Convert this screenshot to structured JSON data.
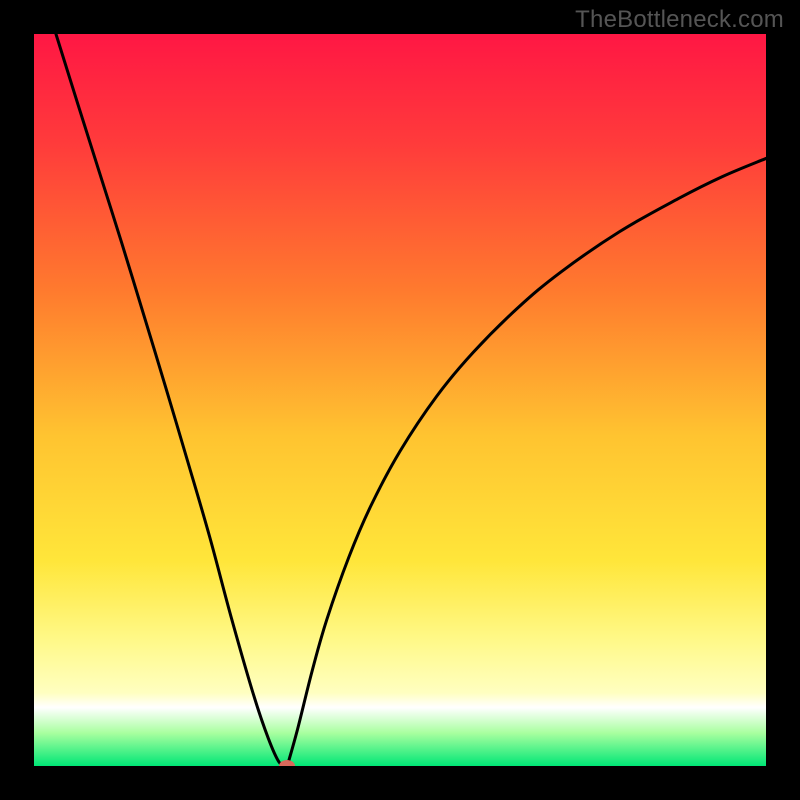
{
  "watermark": "TheBottleneck.com",
  "chart_data": {
    "type": "line",
    "title": "",
    "xlabel": "",
    "ylabel": "",
    "xlim": [
      0,
      100
    ],
    "ylim": [
      0,
      100
    ],
    "grid": false,
    "legend": false,
    "background_gradient_stops": [
      {
        "pct": 0,
        "color": "#ff1744"
      },
      {
        "pct": 15,
        "color": "#ff3b3b"
      },
      {
        "pct": 35,
        "color": "#ff7a2e"
      },
      {
        "pct": 55,
        "color": "#ffc430"
      },
      {
        "pct": 72,
        "color": "#ffe63a"
      },
      {
        "pct": 83,
        "color": "#fff98a"
      },
      {
        "pct": 90,
        "color": "#ffffc0"
      },
      {
        "pct": 92,
        "color": "#ffffff"
      },
      {
        "pct": 95.5,
        "color": "#a8ff9f"
      },
      {
        "pct": 100,
        "color": "#00e676"
      }
    ],
    "series": [
      {
        "name": "left-branch",
        "x": [
          3,
          6,
          9,
          12,
          15,
          18,
          21,
          24,
          27,
          30,
          32,
          33.5,
          34.6
        ],
        "y": [
          100,
          90.4,
          80.9,
          71.4,
          61.6,
          51.7,
          41.6,
          31.3,
          20.1,
          9.7,
          3.8,
          0.5,
          0
        ]
      },
      {
        "name": "right-branch",
        "x": [
          34.6,
          36,
          38,
          40,
          43,
          46,
          50,
          55,
          60,
          66,
          72,
          80,
          88,
          94,
          100
        ],
        "y": [
          0,
          5,
          13,
          20,
          28.5,
          35.5,
          43,
          50.5,
          56.5,
          62.5,
          67.5,
          73,
          77.5,
          80.5,
          83
        ]
      }
    ],
    "marker": {
      "x": 34.6,
      "y": 0,
      "color": "#d9695c"
    },
    "optimum_x": 34.6
  }
}
